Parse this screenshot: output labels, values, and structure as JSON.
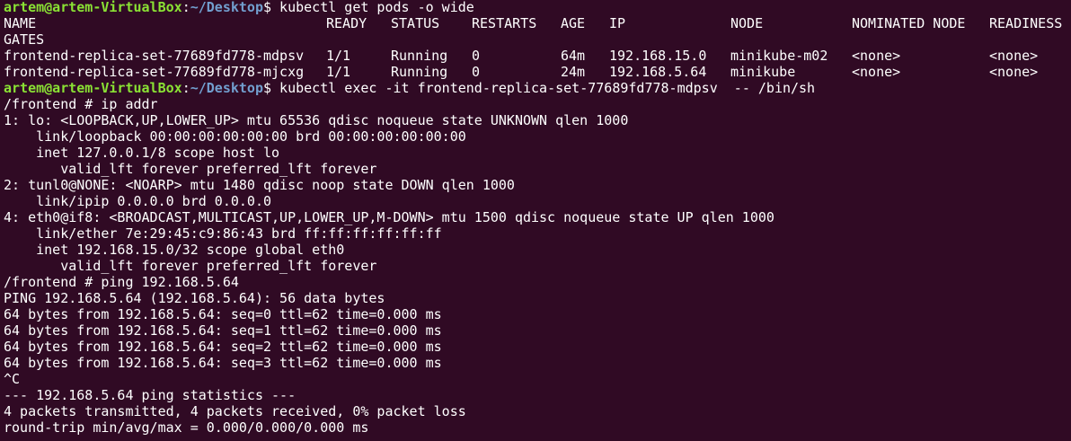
{
  "colors": {
    "background": "#300a24",
    "prompt_user": "#8ae234",
    "prompt_path": "#729fcf",
    "text": "#ffffff"
  },
  "prompt": {
    "user_host": "artem@artem-VirtualBox",
    "path": "~/Desktop",
    "symbol": "$"
  },
  "commands": {
    "get_pods": " kubectl get pods -o wide",
    "exec": " kubectl exec -it frontend-replica-set-77689fd778-mdpsv  -- /bin/sh"
  },
  "pods_table": {
    "headers": {
      "name": "NAME",
      "ready": "READY",
      "status": "STATUS",
      "restarts": "RESTARTS",
      "age": "AGE",
      "ip": "IP",
      "node": "NODE",
      "nominated": "NOMINATED NODE",
      "readiness": "READINESS",
      "gates": "GATES"
    },
    "rows": [
      {
        "name": "frontend-replica-set-77689fd778-mdpsv",
        "ready": "1/1",
        "status": "Running",
        "restarts": "0",
        "age": "64m",
        "ip": "192.168.15.0",
        "node": "minikube-m02",
        "nominated": "<none>",
        "readiness": "<none>"
      },
      {
        "name": "frontend-replica-set-77689fd778-mjcxg",
        "ready": "1/1",
        "status": "Running",
        "restarts": "0",
        "age": "24m",
        "ip": "192.168.5.64",
        "node": "minikube",
        "nominated": "<none>",
        "readiness": "<none>"
      }
    ]
  },
  "shell_output": [
    "/frontend # ip addr",
    "1: lo: <LOOPBACK,UP,LOWER_UP> mtu 65536 qdisc noqueue state UNKNOWN qlen 1000",
    "    link/loopback 00:00:00:00:00:00 brd 00:00:00:00:00:00",
    "    inet 127.0.0.1/8 scope host lo",
    "       valid_lft forever preferred_lft forever",
    "2: tunl0@NONE: <NOARP> mtu 1480 qdisc noop state DOWN qlen 1000",
    "    link/ipip 0.0.0.0 brd 0.0.0.0",
    "4: eth0@if8: <BROADCAST,MULTICAST,UP,LOWER_UP,M-DOWN> mtu 1500 qdisc noqueue state UP qlen 1000",
    "    link/ether 7e:29:45:c9:86:43 brd ff:ff:ff:ff:ff:ff",
    "    inet 192.168.15.0/32 scope global eth0",
    "       valid_lft forever preferred_lft forever",
    "/frontend # ping 192.168.5.64",
    "PING 192.168.5.64 (192.168.5.64): 56 data bytes",
    "64 bytes from 192.168.5.64: seq=0 ttl=62 time=0.000 ms",
    "64 bytes from 192.168.5.64: seq=1 ttl=62 time=0.000 ms",
    "64 bytes from 192.168.5.64: seq=2 ttl=62 time=0.000 ms",
    "64 bytes from 192.168.5.64: seq=3 ttl=62 time=0.000 ms",
    "^C",
    "--- 192.168.5.64 ping statistics ---",
    "4 packets transmitted, 4 packets received, 0% packet loss",
    "round-trip min/avg/max = 0.000/0.000/0.000 ms"
  ]
}
